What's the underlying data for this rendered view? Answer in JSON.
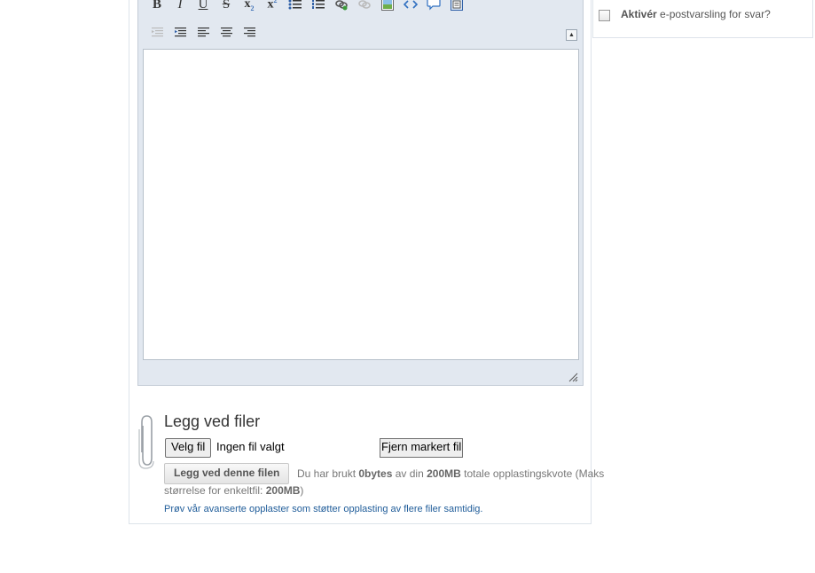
{
  "editor": {
    "toolbar_row1": [
      {
        "name": "bold-button",
        "glyph": "B"
      },
      {
        "name": "italic-button",
        "glyph": "I"
      },
      {
        "name": "underline-button",
        "glyph": "U"
      },
      {
        "name": "strikethrough-button",
        "glyph": "S"
      },
      {
        "name": "subscript-button",
        "glyph": "x₂"
      },
      {
        "name": "superscript-button",
        "glyph": "x²"
      },
      {
        "name": "bullet-list-button",
        "icon": "bullet-list-icon"
      },
      {
        "name": "numbered-list-button",
        "icon": "numbered-list-icon"
      },
      {
        "name": "insert-link-button",
        "icon": "link-icon"
      },
      {
        "name": "remove-link-button",
        "icon": "unlink-icon"
      },
      {
        "name": "insert-image-button",
        "icon": "image-icon"
      },
      {
        "name": "code-button",
        "icon": "code-icon"
      },
      {
        "name": "quote-button",
        "icon": "speech-bubble-icon"
      },
      {
        "name": "paste-button",
        "icon": "paste-icon"
      }
    ],
    "toolbar_row2": [
      {
        "name": "outdent-button",
        "icon": "outdent-icon"
      },
      {
        "name": "indent-button",
        "icon": "indent-icon"
      },
      {
        "name": "align-left-button",
        "icon": "align-left-icon"
      },
      {
        "name": "align-center-button",
        "icon": "align-center-icon"
      },
      {
        "name": "align-right-button",
        "icon": "align-right-icon"
      }
    ]
  },
  "attach": {
    "title": "Legg ved filer",
    "choose_file": "Velg fil",
    "no_file": "Ingen fil valgt",
    "remove_selected": "Fjern markert fil",
    "upload_button": "Legg ved denne filen",
    "quota_prefix": "Du har brukt",
    "quota_used": "0bytes",
    "quota_mid": "av din",
    "quota_total": "200MB",
    "quota_suffix": "totale opplastingskvote (Maks størrelse for enkeltfil:",
    "quota_max_file": "200MB",
    "quota_close": ")",
    "advanced_link": "Prøv vår avanserte opplaster som støtter opplasting av flere filer samtidig."
  },
  "sidebar": {
    "notify_bold": "Aktivér",
    "notify_rest": " e-postvarsling for svar?"
  },
  "colors": {
    "editor_bg": "#e2e8f0",
    "link": "#1f5c99",
    "text_muted": "#777777"
  }
}
